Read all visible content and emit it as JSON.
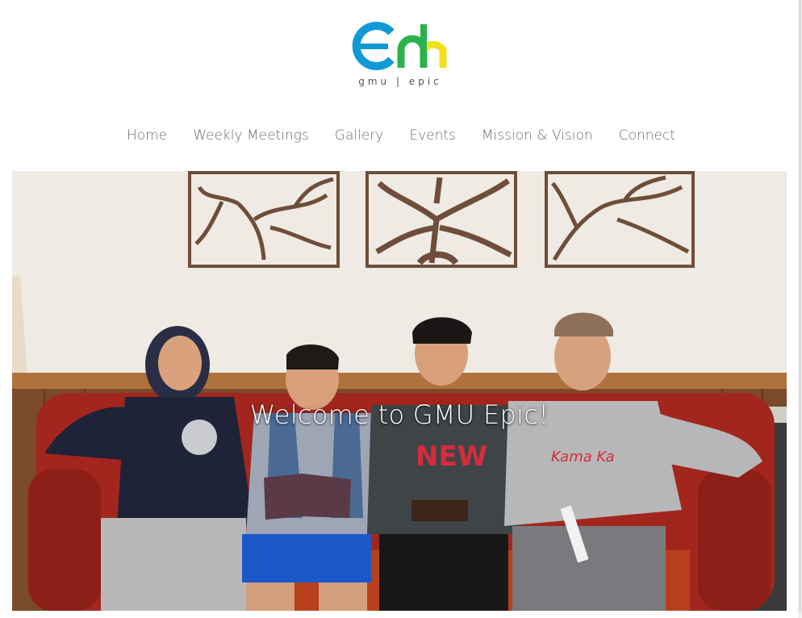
{
  "site": {
    "logo_text": "gmu | epic",
    "colors": {
      "logo_blue": "#0f9ad6",
      "logo_green": "#2bb24c",
      "logo_yellow": "#f2e11e"
    }
  },
  "nav": {
    "items": [
      {
        "label": "Home"
      },
      {
        "label": "Weekly Meetings"
      },
      {
        "label": "Gallery"
      },
      {
        "label": "Events"
      },
      {
        "label": "Mission & Vision"
      },
      {
        "label": "Connect"
      }
    ]
  },
  "hero": {
    "title": "Welcome to GMU Epic!"
  }
}
